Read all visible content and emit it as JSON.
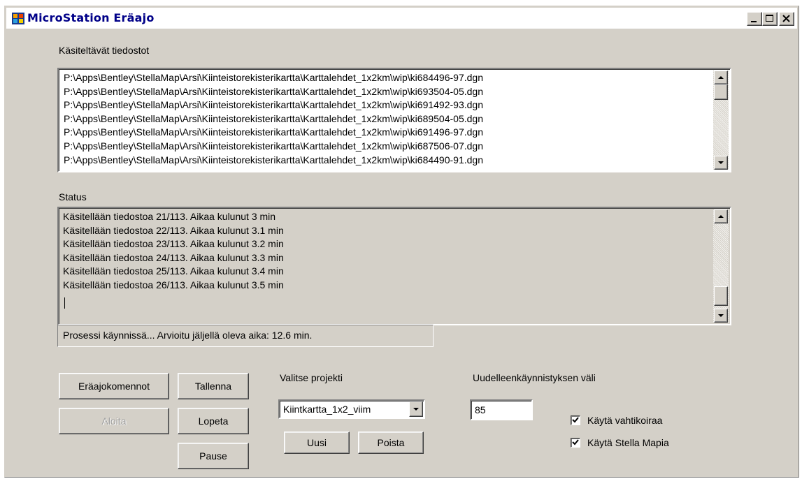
{
  "window": {
    "title": "MicroStation Eräajo"
  },
  "files": {
    "label": "Käsiteltävät tiedostot",
    "items": [
      "P:\\Apps\\Bentley\\StellaMap\\Arsi\\Kiinteistorekisterikartta\\Karttalehdet_1x2km\\wip\\ki684496-97.dgn",
      "P:\\Apps\\Bentley\\StellaMap\\Arsi\\Kiinteistorekisterikartta\\Karttalehdet_1x2km\\wip\\ki693504-05.dgn",
      "P:\\Apps\\Bentley\\StellaMap\\Arsi\\Kiinteistorekisterikartta\\Karttalehdet_1x2km\\wip\\ki691492-93.dgn",
      "P:\\Apps\\Bentley\\StellaMap\\Arsi\\Kiinteistorekisterikartta\\Karttalehdet_1x2km\\wip\\ki689504-05.dgn",
      "P:\\Apps\\Bentley\\StellaMap\\Arsi\\Kiinteistorekisterikartta\\Karttalehdet_1x2km\\wip\\ki691496-97.dgn",
      "P:\\Apps\\Bentley\\StellaMap\\Arsi\\Kiinteistorekisterikartta\\Karttalehdet_1x2km\\wip\\ki687506-07.dgn",
      "P:\\Apps\\Bentley\\StellaMap\\Arsi\\Kiinteistorekisterikartta\\Karttalehdet_1x2km\\wip\\ki684490-91.dgn"
    ]
  },
  "status": {
    "label": "Status",
    "lines": [
      "Käsitellään tiedostoa 21/113. Aikaa kulunut 3 min",
      "Käsitellään tiedostoa 22/113. Aikaa kulunut 3.1 min",
      "Käsitellään tiedostoa 23/113. Aikaa kulunut 3.2 min",
      "Käsitellään tiedostoa 24/113. Aikaa kulunut 3.3 min",
      "Käsitellään tiedostoa 25/113. Aikaa kulunut 3.4 min",
      "Käsitellään tiedostoa 26/113. Aikaa kulunut 3.5 min"
    ]
  },
  "progress": {
    "text": "Prosessi käynnissä... Arvioitu jäljellä oleva aika: 12.6 min."
  },
  "buttons": {
    "batch_commands": "Eräajokomennot",
    "start": "Aloita",
    "save": "Tallenna",
    "stop": "Lopeta",
    "pause": "Pause",
    "new": "Uusi",
    "delete": "Poista"
  },
  "project": {
    "label": "Valitse projekti",
    "selected": "Kiintkartta_1x2_viim"
  },
  "restart": {
    "label": "Uudelleenkäynnistyksen väli",
    "value": "85"
  },
  "options": {
    "watchdog_label": "Käytä vahtikoiraa",
    "watchdog_checked": true,
    "stella_label": "Käytä Stella Mapia",
    "stella_checked": true
  },
  "icons": {
    "app": "microstation-app-icon",
    "minimize": "minimize-icon",
    "maximize": "maximize-icon",
    "close": "close-icon"
  }
}
